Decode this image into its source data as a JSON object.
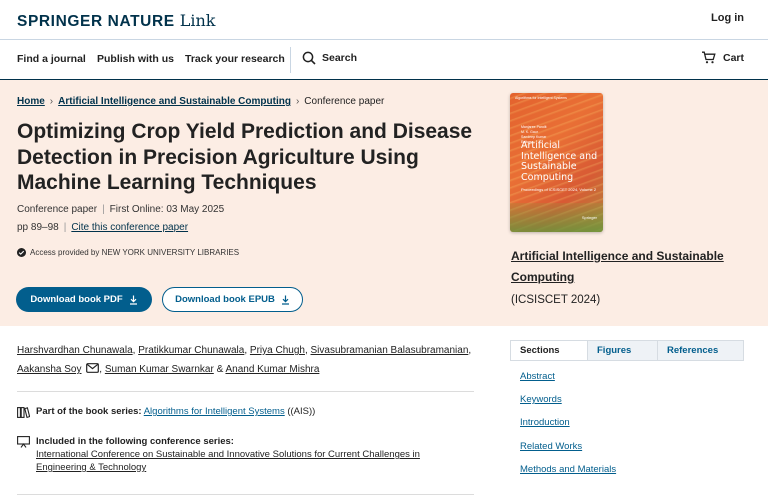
{
  "header": {
    "brand": "SPRINGER NATURE",
    "brand_suffix": "Link",
    "login": "Log in"
  },
  "nav": {
    "find_journal": "Find a journal",
    "publish": "Publish with us",
    "track": "Track your research",
    "search": "Search",
    "cart": "Cart"
  },
  "breadcrumb": {
    "home": "Home",
    "book": "Artificial Intelligence and Sustainable Computing",
    "current": "Conference paper"
  },
  "paper": {
    "title": "Optimizing Crop Yield Prediction and Disease Detection in Precision Agriculture Using Machine Learning Techniques",
    "type": "Conference paper",
    "first_online": "First Online: 03 May 2025",
    "pages": "pp 89–98",
    "cite": "Cite this conference paper",
    "access": "Access provided by NEW YORK UNIVERSITY LIBRARIES"
  },
  "buttons": {
    "pdf": "Download book PDF",
    "epub": "Download book EPUB"
  },
  "book": {
    "title": "Artificial Intelligence and Sustainable Computing",
    "subtitle": "(ICSISCET 2024)",
    "cover_series": "Algorithms for Intelligent Systems",
    "cover_editors": [
      "Manjaree Pandit",
      "M. K. Gaur",
      "Sandeep Kumar",
      "Editors"
    ],
    "cover_title": "Artificial Intelligence and Sustainable Computing",
    "cover_proceedings": "Proceedings of ICSISCET 2024, Volume 2",
    "cover_publisher": "Springer"
  },
  "authors": {
    "a1": "Harshvardhan Chunawala",
    "a2": "Pratikkumar Chunawala",
    "a3": "Priya Chugh",
    "a4": "Sivasubramanian Balasubramanian",
    "a5": "Aakansha Soy",
    "a6": "Suman Kumar Swarnkar",
    "amp": "&",
    "a7": "Anand Kumar Mishra"
  },
  "series": {
    "label": "Part of the book series:",
    "name": "Algorithms for Intelligent Systems",
    "abbr": "((AIS))"
  },
  "conference": {
    "label": "Included in the following conference series:",
    "name": "International Conference on Sustainable and Innovative Solutions for Current Challenges in Engineering & Technology"
  },
  "sidebar": {
    "tabs": [
      "Sections",
      "Figures",
      "References"
    ],
    "links": [
      "Abstract",
      "Keywords",
      "Introduction",
      "Related Works",
      "Methods and Materials"
    ]
  },
  "colors": {
    "brand": "#01324b",
    "accent": "#025e8d",
    "hero_bg": "#fcede4"
  }
}
